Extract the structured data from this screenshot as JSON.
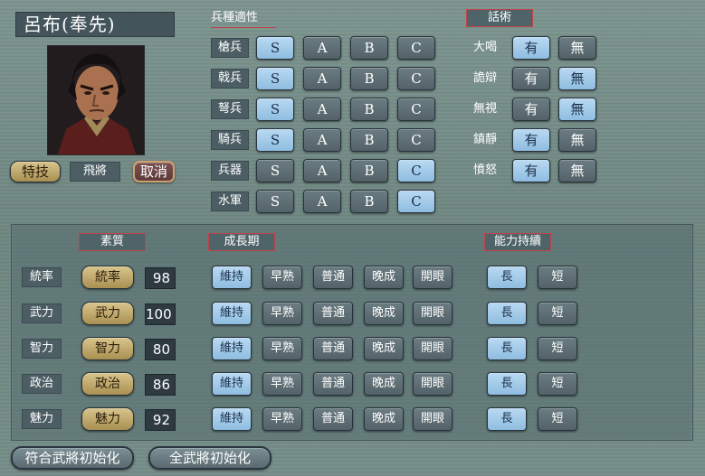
{
  "general": {
    "name": "呂布(奉先)",
    "special_skill_label": "特技",
    "special_skill_value": "飛將",
    "cancel_label": "取消"
  },
  "troop_section": {
    "title": "兵種適性",
    "grade_labels": [
      "S",
      "A",
      "B",
      "C"
    ],
    "rows": [
      {
        "label": "槍兵",
        "selected": "S"
      },
      {
        "label": "戟兵",
        "selected": "S"
      },
      {
        "label": "弩兵",
        "selected": "S"
      },
      {
        "label": "騎兵",
        "selected": "S"
      },
      {
        "label": "兵器",
        "selected": "C"
      },
      {
        "label": "水軍",
        "selected": "C"
      }
    ]
  },
  "debate_section": {
    "title": "話術",
    "yes_label": "有",
    "no_label": "無",
    "rows": [
      {
        "label": "大喝",
        "selected": "有"
      },
      {
        "label": "詭辯",
        "selected": "無"
      },
      {
        "label": "無視",
        "selected": "無"
      },
      {
        "label": "鎮靜",
        "selected": "有"
      },
      {
        "label": "憤怒",
        "selected": "有"
      }
    ]
  },
  "stats_section": {
    "quality_title": "素質",
    "growth_title": "成長期",
    "duration_title": "能力持續",
    "growth_options": [
      "維持",
      "早熟",
      "普通",
      "晚成",
      "開眼"
    ],
    "duration_options": [
      "長",
      "短"
    ],
    "rows": [
      {
        "label": "統率",
        "button": "統率",
        "value": "98",
        "growth": "維持",
        "duration": "長"
      },
      {
        "label": "武力",
        "button": "武力",
        "value": "100",
        "growth": "維持",
        "duration": "長"
      },
      {
        "label": "智力",
        "button": "智力",
        "value": "80",
        "growth": "維持",
        "duration": "長"
      },
      {
        "label": "政治",
        "button": "政治",
        "value": "86",
        "growth": "維持",
        "duration": "長"
      },
      {
        "label": "魅力",
        "button": "魅力",
        "value": "92",
        "growth": "維持",
        "duration": "長"
      }
    ]
  },
  "footer": {
    "init_matching_label": "符合武將初始化",
    "init_all_label": "全武將初始化"
  },
  "colors": {
    "selected_button": "#9fcbea",
    "normal_button": "#5e6e74",
    "accent_red": "#c4414a",
    "gold_button": "#c4ad6c"
  }
}
